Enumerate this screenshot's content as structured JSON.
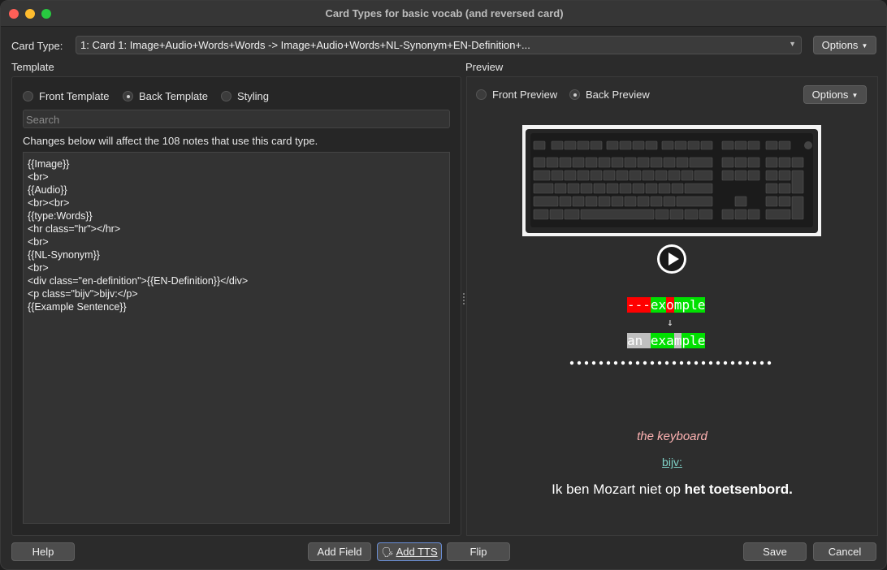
{
  "window": {
    "title": "Card Types for basic vocab (and reversed card)"
  },
  "card_type": {
    "label": "Card Type:",
    "selected": "1: Card 1: Image+Audio+Words+Words -> Image+Audio+Words+NL-Synonym+EN-Definition+...",
    "options_label": "Options"
  },
  "template": {
    "section_label": "Template",
    "radios": [
      {
        "label": "Front Template",
        "selected": false
      },
      {
        "label": "Back Template",
        "selected": true
      },
      {
        "label": "Styling",
        "selected": false
      }
    ],
    "search_placeholder": "Search",
    "notice": "Changes below will affect the 108 notes that use this card type.",
    "code_lines": [
      "{{Image}}",
      "<br>",
      "{{Audio}}",
      "<br><br>",
      "{{type:Words}}",
      "<hr class=\"hr\"></hr>",
      "<br>",
      "{{NL-Synonym}}",
      "<br>",
      "<div class=\"en-definition\">{{EN-Definition}}</div>",
      "<p class=\"bijv\">bijv:</p>",
      "{{Example Sentence}}"
    ]
  },
  "preview": {
    "section_label": "Preview",
    "radios": [
      {
        "label": "Front Preview",
        "selected": false
      },
      {
        "label": "Back Preview",
        "selected": true
      }
    ],
    "options_label": "Options",
    "typed_answer": {
      "typed_bad_1": "---",
      "typed_good_1": "ex",
      "typed_bad_2": "o",
      "typed_good_2": "mple",
      "arrow": "↓",
      "expected_missed_1": "an ",
      "expected_good_1": "exa",
      "expected_missed_2": "m",
      "expected_good_2": "ple"
    },
    "definition": "the keyboard",
    "bijv": "bijv:",
    "sentence_plain": "Ik ben Mozart niet op ",
    "sentence_bold": "het toetsenbord."
  },
  "footer": {
    "help": "Help",
    "add_field": "Add Field",
    "add_tts": "Add TTS",
    "flip": "Flip",
    "save": "Save",
    "cancel": "Cancel"
  },
  "colors": {
    "wrong": "#ff0000",
    "correct": "#00e000",
    "missing": "#bfbfbf",
    "definition": "#ffb3b3",
    "bijv": "#7fd1c6"
  }
}
